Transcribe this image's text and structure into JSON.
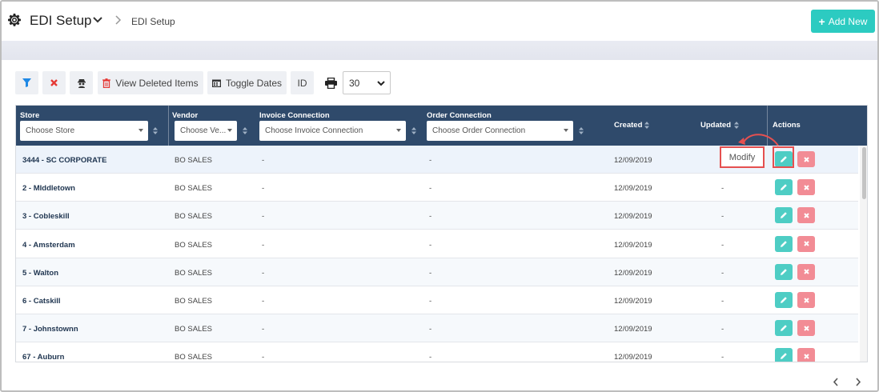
{
  "header": {
    "title": "EDI Setup",
    "breadcrumb": "EDI Setup",
    "add_new_label": "Add New",
    "add_new_icon": "plus-icon"
  },
  "toolbar": {
    "view_deleted_label": "View Deleted Items",
    "toggle_dates_label": "Toggle Dates",
    "id_label": "ID",
    "page_size": "30"
  },
  "table": {
    "columns": {
      "store": "Store",
      "vendor": "Vendor",
      "invoice": "Invoice Connection",
      "order": "Order Connection",
      "created": "Created",
      "updated": "Updated",
      "actions": "Actions"
    },
    "filters": {
      "store": "Choose Store",
      "vendor": "Choose Ve...",
      "invoice": "Choose Invoice Connection",
      "order": "Choose Order Connection"
    },
    "rows": [
      {
        "store": "3444 - SC CORPORATE",
        "vendor": "BO SALES",
        "invoice": "-",
        "order": "-",
        "created": "12/09/2019",
        "updated": ""
      },
      {
        "store": "2 - MIddletown",
        "vendor": "BO SALES",
        "invoice": "-",
        "order": "-",
        "created": "12/09/2019",
        "updated": "-"
      },
      {
        "store": "3 - Cobleskill",
        "vendor": "BO SALES",
        "invoice": "-",
        "order": "-",
        "created": "12/09/2019",
        "updated": "-"
      },
      {
        "store": "4 - Amsterdam",
        "vendor": "BO SALES",
        "invoice": "-",
        "order": "-",
        "created": "12/09/2019",
        "updated": "-"
      },
      {
        "store": "5 - Walton",
        "vendor": "BO SALES",
        "invoice": "-",
        "order": "-",
        "created": "12/09/2019",
        "updated": "-"
      },
      {
        "store": "6 - Catskill",
        "vendor": "BO SALES",
        "invoice": "-",
        "order": "-",
        "created": "12/09/2019",
        "updated": "-"
      },
      {
        "store": "7 - Johnstownn",
        "vendor": "BO SALES",
        "invoice": "-",
        "order": "-",
        "created": "12/09/2019",
        "updated": "-"
      },
      {
        "store": "67 - Auburn",
        "vendor": "BO SALES",
        "invoice": "-",
        "order": "-",
        "created": "12/09/2019",
        "updated": "-"
      }
    ]
  },
  "tooltip": {
    "modify_label": "Modify"
  },
  "colors": {
    "accent": "#2ccbc1",
    "header_bg": "#2f4a6b",
    "edit_btn": "#4ecdc4",
    "delete_btn": "#f28c95",
    "filter_icon": "#1e88e5",
    "clear_icon": "#e53935",
    "delete_icon": "#e53935",
    "highlight": "#e55050"
  }
}
